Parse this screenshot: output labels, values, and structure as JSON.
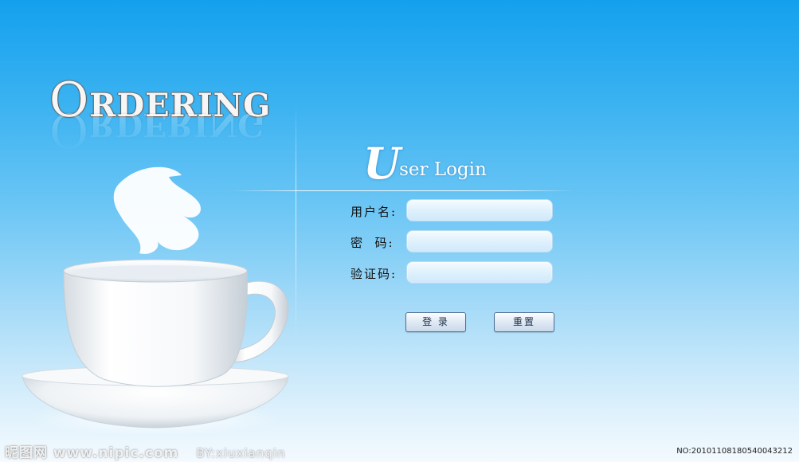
{
  "logo": {
    "first": "O",
    "rest": "RDERING"
  },
  "login": {
    "title_initial": "U",
    "title_rest": "ser Login",
    "fields": [
      {
        "label": "用户名:",
        "value": "",
        "placeholder": ""
      },
      {
        "label": "密  码:",
        "value": "",
        "placeholder": ""
      },
      {
        "label": "验证码:",
        "value": "",
        "placeholder": ""
      }
    ],
    "buttons": {
      "login": "登 录",
      "reset": "重置"
    }
  },
  "watermark": {
    "site": "昵图网 www.nipic.com",
    "by": "BY:xiuxianqin"
  },
  "serial": "NO:20101108180540043212",
  "colors": {
    "bg_top": "#14a0ee",
    "bg_bottom": "#f4fafe",
    "field_fill": "#dcf0fc",
    "button_border": "#4d6f93"
  },
  "icons": {
    "cup": "coffee-cup-illustration",
    "steam": "steam-swirl"
  }
}
